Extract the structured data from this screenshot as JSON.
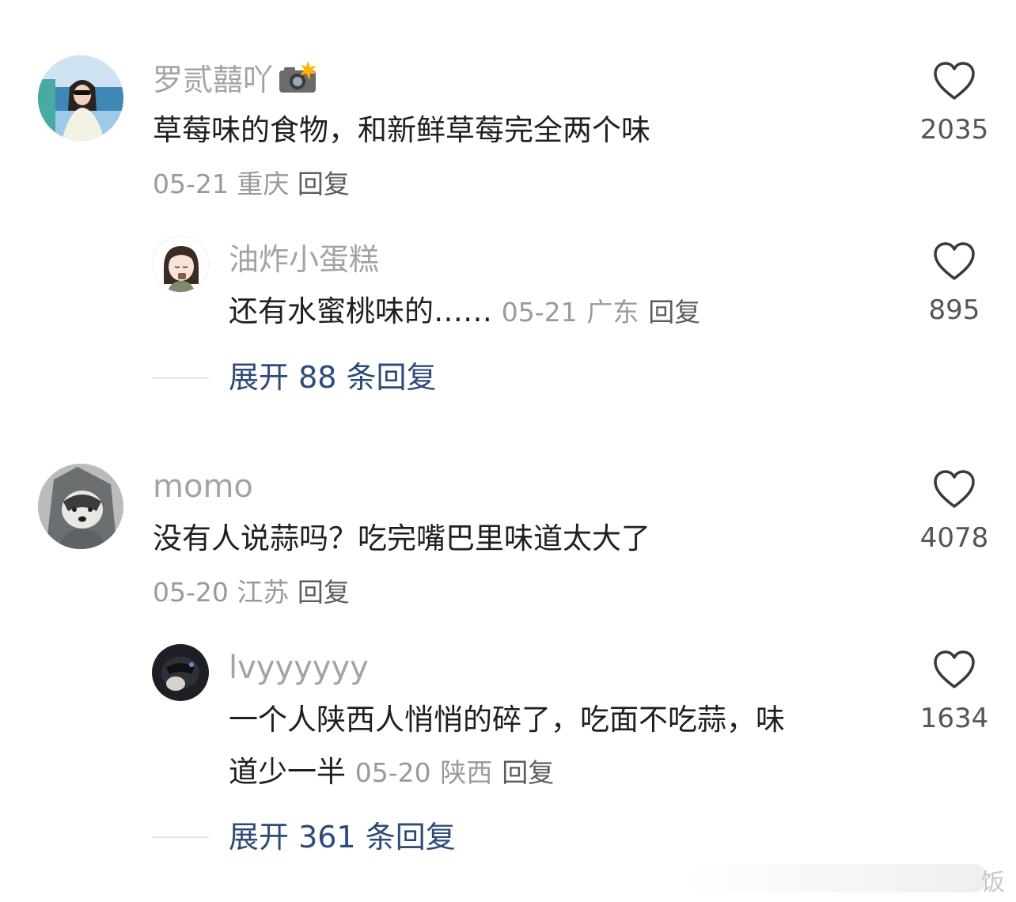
{
  "comments": [
    {
      "user": "罗贰囍吖",
      "badge_icon": "camera-flash-emoji",
      "text": "草莓味的食物，和新鲜草莓完全两个味",
      "date": "05-21",
      "location": "重庆",
      "reply_label": "回复",
      "likes": "2035",
      "replies": [
        {
          "user": "油炸小蛋糕",
          "text": "还有水蜜桃味的……",
          "date": "05-21",
          "location": "广东",
          "reply_label": "回复",
          "likes": "895"
        }
      ],
      "expand_label": "展开 88 条回复"
    },
    {
      "user": "momo",
      "text": "没有人说蒜吗？吃完嘴巴里味道太大了",
      "date": "05-20",
      "location": "江苏",
      "reply_label": "回复",
      "likes": "4078",
      "replies": [
        {
          "user": "lvyyyyyy",
          "text_line1": "一个人陕西人悄悄的碎了，吃面不吃蒜，味",
          "text_line2": "道少一半",
          "date": "05-20",
          "location": "陕西",
          "reply_label": "回复",
          "likes": "1634"
        }
      ],
      "expand_label": "展开 361 条回复"
    }
  ],
  "watermark": "饭"
}
